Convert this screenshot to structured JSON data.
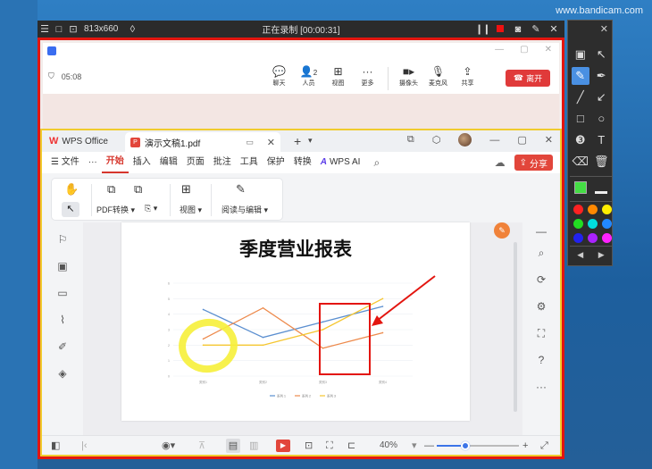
{
  "watermark": "www.bandicam.com",
  "bandicam": {
    "size": "813x660",
    "recording_text": "正在录制 [00:00:31]"
  },
  "meeting": {
    "time": "05:08",
    "tools": [
      {
        "icon": "chat-icon",
        "label": "聊天"
      },
      {
        "icon": "people-icon",
        "label": "人员",
        "badge": "2"
      },
      {
        "icon": "view-icon",
        "label": "视图"
      },
      {
        "icon": "more-icon",
        "label": "更多"
      },
      {
        "icon": "camera-icon",
        "label": "摄像头"
      },
      {
        "icon": "mic-icon",
        "label": "麦克风"
      },
      {
        "icon": "share-icon",
        "label": "共享"
      }
    ],
    "leave_label": "离开"
  },
  "wps": {
    "app_tab": "WPS Office",
    "doc_tab": "演示文稿1.pdf",
    "menu": {
      "file": "文件",
      "more": "···",
      "items": [
        "开始",
        "插入",
        "编辑",
        "页面",
        "批注",
        "工具",
        "保护",
        "转换"
      ],
      "active": "开始",
      "wps_ai": "WPS AI",
      "share": "分享"
    },
    "ribbon": {
      "pdf_convert": "PDF转换",
      "view": "视图",
      "read_edit": "阅读与编辑"
    },
    "status": {
      "zoom": "40%",
      "zoom_fraction": 0.35
    }
  },
  "page": {
    "title": "季度营业报表"
  },
  "chart_data": {
    "type": "line",
    "categories": [
      "类别1",
      "类别2",
      "类别3",
      "类别4"
    ],
    "ylim": [
      0,
      6
    ],
    "yticks": [
      "0",
      "1",
      "2",
      "3",
      "4",
      "5",
      "6"
    ],
    "series": [
      {
        "name": "系列 1",
        "color": "#5b8fd0",
        "values": [
          4.3,
          2.5,
          3.5,
          4.5
        ]
      },
      {
        "name": "系列 2",
        "color": "#ed8a4c",
        "values": [
          2.4,
          4.4,
          1.8,
          2.8
        ]
      },
      {
        "name": "系列 3",
        "color": "#f5c630",
        "values": [
          2.0,
          2.0,
          3.0,
          5.0
        ]
      }
    ]
  },
  "annotations": {
    "highlight_color": "#f6f03a",
    "rect_color": "#e3150f",
    "arrow_color": "#e3150f"
  },
  "draw_toolbar": {
    "colors": [
      "#ff2222",
      "#ff8800",
      "#ffee00",
      "#22dd22",
      "#00dddd",
      "#2288ff",
      "#2222ee",
      "#aa22ff",
      "#ff22ff"
    ]
  }
}
